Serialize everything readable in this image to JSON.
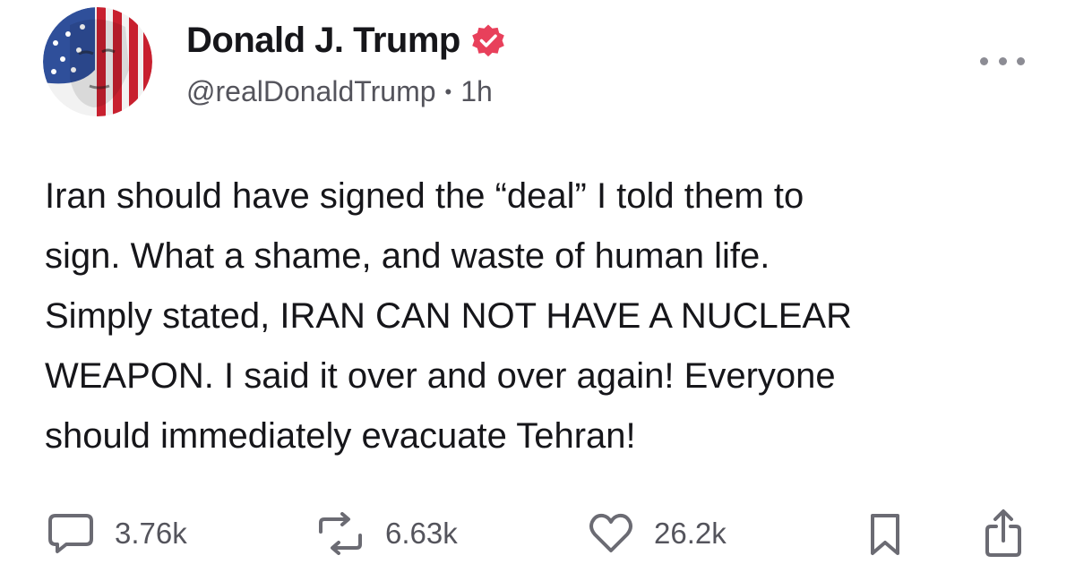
{
  "author": {
    "display_name": "Donald J. Trump",
    "handle": "@realDonaldTrump",
    "separator": "•",
    "timestamp": "1h",
    "verified": true
  },
  "post": {
    "lines": [
      "Iran should have signed the “deal” I told them to",
      "sign. What a shame, and waste of human life.",
      "Simply stated, IRAN CAN NOT HAVE A NUCLEAR",
      "WEAPON. I said it over and over again! Everyone",
      "should immediately evacuate Tehran!"
    ]
  },
  "actions": {
    "reply_count": "3.76k",
    "repost_count": "6.63k",
    "like_count": "26.2k"
  },
  "icons": {
    "avatar": "flag-face-avatar",
    "verified": "verified-badge-icon",
    "more": "more-options-icon",
    "reply": "reply-bubble-icon",
    "repost": "repost-icon",
    "like": "heart-icon",
    "bookmark": "bookmark-icon",
    "share": "share-icon"
  },
  "colors": {
    "text": "#16161a",
    "muted": "#54545c",
    "verified": "#e8405b",
    "icon": "#6b6b73"
  }
}
